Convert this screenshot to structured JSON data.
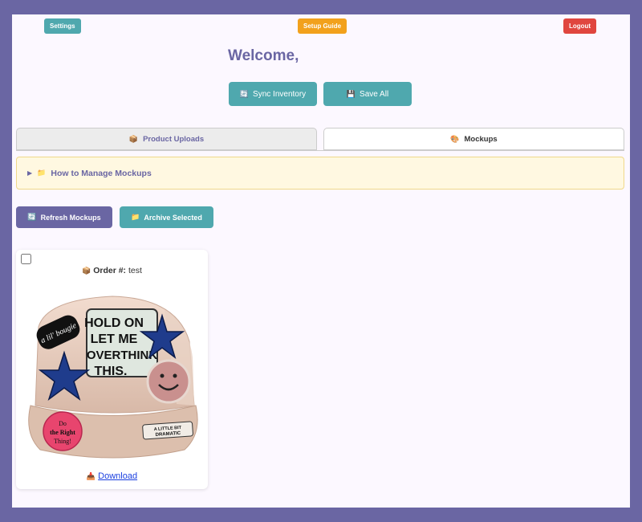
{
  "header": {
    "settings_label": "Settings",
    "setup_guide_label": "Setup Guide",
    "logout_label": "Logout",
    "welcome_text": "Welcome,"
  },
  "actions": {
    "sync_icon": "🔄",
    "sync_label": "Sync Inventory",
    "save_icon": "💾",
    "save_label": "Save All"
  },
  "tabs": [
    {
      "icon": "📦",
      "label": "Product Uploads",
      "active": false
    },
    {
      "icon": "🎨",
      "label": "Mockups",
      "active": true
    }
  ],
  "help": {
    "triangle": "▶",
    "icon": "📁",
    "label": "How to Manage Mockups"
  },
  "mockup_actions": {
    "refresh_icon": "🔄",
    "refresh_label": "Refresh Mockups",
    "archive_icon": "📁",
    "archive_label": "Archive Selected"
  },
  "mockups": [
    {
      "order_icon": "📦",
      "order_label": "Order #:",
      "order_value": "test",
      "image": {
        "patches": [
          "a lil' bougie",
          "HOLD ON",
          "LET ME",
          "OVERTHINK",
          "THIS.",
          "Do",
          "the Right",
          "Thing!",
          "A LITTLE BIT",
          "DRAMATIC"
        ]
      },
      "download_icon": "📥",
      "download_label": "Download"
    }
  ],
  "colors": {
    "background": "#6a66a3",
    "panel": "#fcf8ff",
    "teal": "#4fa8ae",
    "orange": "#f2a11c",
    "red": "#e0463f",
    "purple": "#6a66a3",
    "help_bg": "#fff8e1"
  }
}
